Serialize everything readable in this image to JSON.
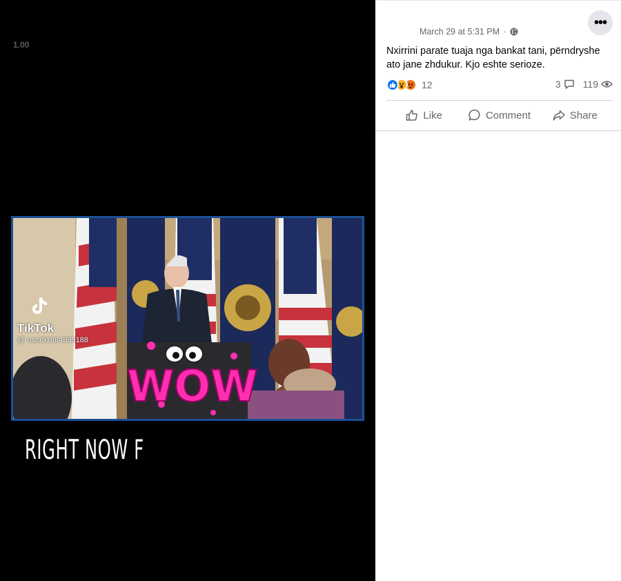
{
  "video": {
    "speed_label": "1.00",
    "watermark_brand": "TikTok",
    "watermark_user": "@ user51884595188",
    "sticker_text": "WOW",
    "caption": "RIGHT NOW F"
  },
  "post": {
    "timestamp": "March 29 at 5:31 PM",
    "separator": "·",
    "privacy_icon": "globe-icon",
    "more_label": "•••",
    "text": "Nxirrini parate tuaja nga bankat tani, përndryshe ato jane zhdukur. Kjo eshte serioze.",
    "reactions": {
      "types": [
        "like",
        "wow",
        "angry"
      ],
      "count": "12"
    },
    "comments_count": "3",
    "views_count": "119",
    "actions": {
      "like": "Like",
      "comment": "Comment",
      "share": "Share"
    }
  },
  "colors": {
    "facebook_blue": "#1877f2",
    "secondary_text": "#65676b",
    "video_frame_border": "#1d4f95",
    "sticker_pink": "#ff2fb0"
  }
}
